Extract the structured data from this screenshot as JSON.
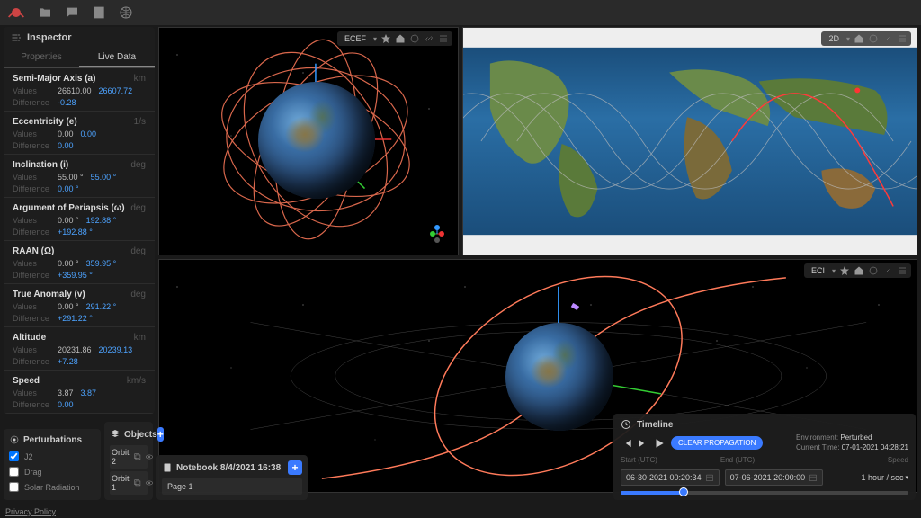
{
  "topbar": {
    "icons": [
      "folder",
      "chat",
      "contact",
      "globe"
    ]
  },
  "inspector": {
    "title": "Inspector",
    "tabs": {
      "properties": "Properties",
      "livedata": "Live Data"
    },
    "params": [
      {
        "name": "Semi-Major Axis (a)",
        "unit": "km",
        "v1": "26610.00",
        "v2": "26607.72",
        "diff": "-0.28"
      },
      {
        "name": "Eccentricity (e)",
        "unit": "1/s",
        "v1": "0.00",
        "v2": "0.00",
        "diff": "0.00"
      },
      {
        "name": "Inclination (i)",
        "unit": "deg",
        "v1": "55.00 °",
        "v2": "55.00 °",
        "diff": "0.00 °"
      },
      {
        "name": "Argument of Periapsis (ω)",
        "unit": "deg",
        "v1": "0.00 °",
        "v2": "192.88 °",
        "diff": "+192.88 °"
      },
      {
        "name": "RAAN (Ω)",
        "unit": "deg",
        "v1": "0.00 °",
        "v2": "359.95 °",
        "diff": "+359.95 °"
      },
      {
        "name": "True Anomaly (v)",
        "unit": "deg",
        "v1": "0.00 °",
        "v2": "291.22 °",
        "diff": "+291.22 °"
      },
      {
        "name": "Altitude",
        "unit": "km",
        "v1": "20231.86",
        "v2": "20239.13",
        "diff": "+7.28"
      },
      {
        "name": "Speed",
        "unit": "km/s",
        "v1": "3.87",
        "v2": "3.87",
        "diff": "0.00"
      }
    ],
    "row_labels": {
      "values": "Values",
      "difference": "Difference"
    }
  },
  "viewports": {
    "tl": {
      "mode": "ECEF"
    },
    "tr": {
      "mode": "2D"
    },
    "b": {
      "mode": "ECI"
    }
  },
  "perturbations": {
    "title": "Perturbations",
    "items": [
      {
        "label": "J2",
        "checked": true
      },
      {
        "label": "Drag",
        "checked": false
      },
      {
        "label": "Solar Radiation",
        "checked": false
      }
    ]
  },
  "objects": {
    "title": "Objects",
    "items": [
      {
        "label": "Orbit 2"
      },
      {
        "label": "Orbit 1"
      }
    ]
  },
  "notebook": {
    "title": "Notebook 8/4/2021 16:38",
    "page": "Page 1"
  },
  "timeline": {
    "title": "Timeline",
    "clear": "CLEAR PROPAGATION",
    "env_label": "Environment:",
    "env_value": "Perturbed",
    "time_label": "Current Time:",
    "time_value": "07-01-2021 04:28:21",
    "start_label": "Start (UTC)",
    "end_label": "End (UTC)",
    "speed_label": "Speed",
    "start": "06-30-2021 00:20:34",
    "end": "07-06-2021 20:00:00",
    "speed": "1 hour / sec"
  },
  "footer": {
    "privacy": "Privacy Policy"
  }
}
